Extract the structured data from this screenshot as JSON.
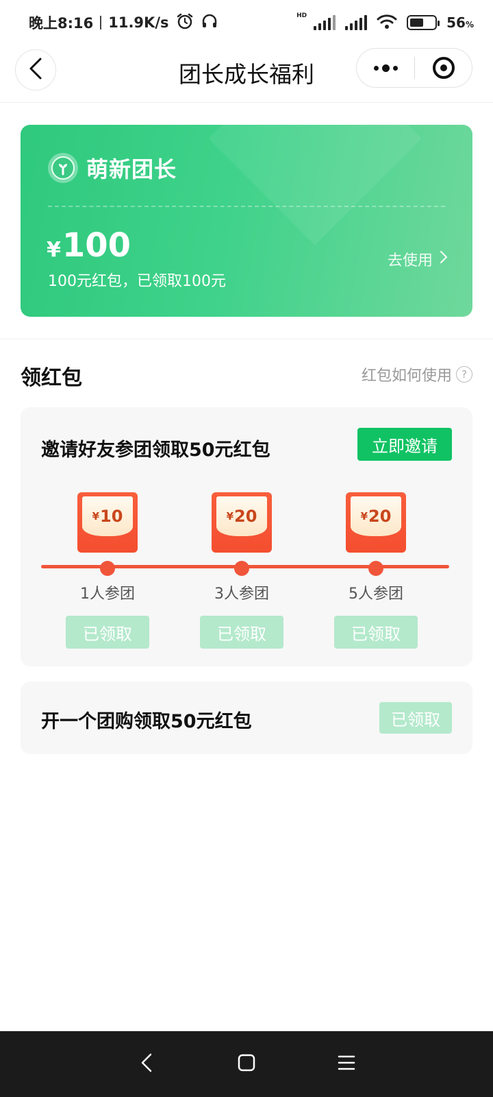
{
  "status_bar": {
    "time": "晚上8:16",
    "net_speed": "11.9K/s",
    "hd_label": "HD",
    "battery_percent": "56",
    "battery_unit": "%",
    "battery_level": 0.56,
    "icons": [
      "alarm-icon",
      "headset-icon",
      "signal-icon",
      "wifi-icon",
      "battery-icon"
    ]
  },
  "navbar": {
    "title": "团长成长福利",
    "back_icon": "chevron-left-icon",
    "more_icon": "more-dots-icon",
    "close_icon": "target-ring-icon"
  },
  "hero": {
    "level_name": "萌新团长",
    "currency": "¥",
    "amount": "100",
    "description": "100元红包，已领取100元",
    "use_label": "去使用",
    "colors": {
      "start": "#2fc97d",
      "end": "#6fd89c"
    }
  },
  "section": {
    "title": "领红包",
    "help_label": "红包如何使用",
    "help_icon": "question-icon"
  },
  "invite_card": {
    "title": "邀请好友参团领取50元红包",
    "button_label": "立即邀请",
    "tiers": [
      {
        "currency": "¥",
        "amount": "10",
        "label": "1人参团",
        "status": "已领取"
      },
      {
        "currency": "¥",
        "amount": "20",
        "label": "3人参团",
        "status": "已领取"
      },
      {
        "currency": "¥",
        "amount": "20",
        "label": "5人参团",
        "status": "已领取"
      }
    ]
  },
  "open_card": {
    "title": "开一个团购领取50元红包",
    "status": "已领取"
  },
  "colors": {
    "accent_green": "#10c263",
    "claimed_green": "#b4e9cc",
    "red": "#f0553a"
  }
}
